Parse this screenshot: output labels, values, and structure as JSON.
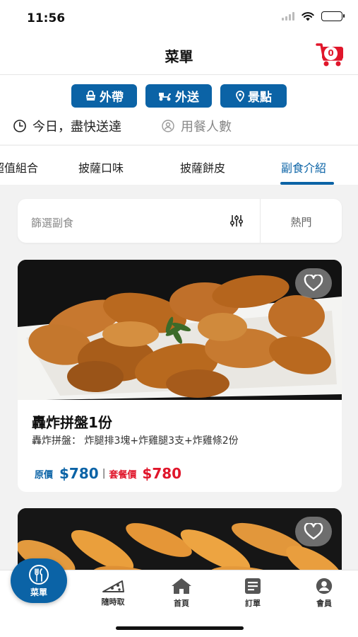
{
  "status_bar": {
    "time": "11:56"
  },
  "header": {
    "title": "菜單",
    "cart_count": "0"
  },
  "order_modes": [
    {
      "label": "外帶",
      "icon": "takeout-icon"
    },
    {
      "label": "外送",
      "icon": "delivery-scooter-icon"
    },
    {
      "label": "景點",
      "icon": "location-pin-icon"
    }
  ],
  "delivery_info": {
    "time_text": "今日，盡快送達",
    "diners_text": "用餐人數"
  },
  "category_tabs": [
    {
      "label": "超值組合"
    },
    {
      "label": "披薩口味"
    },
    {
      "label": "披薩餅皮"
    },
    {
      "label": "副食介紹",
      "active": true
    }
  ],
  "filter": {
    "label": "篩選副食",
    "sort": "熱門"
  },
  "products": [
    {
      "title": "轟炸拼盤1份",
      "description": "轟炸拼盤： 炸腿排3塊+炸雞腿3支+炸雞條2份",
      "original_price_label": "原價",
      "original_price": "$780",
      "separator": "|",
      "set_price_label": "套餐價",
      "set_price": "$780"
    },
    {
      "title": ""
    }
  ],
  "bottom_nav": {
    "items": [
      {
        "label": "菜單",
        "icon": "cutlery-icon",
        "active": true
      },
      {
        "label": "隨時取",
        "icon": "pizza-slice-icon"
      },
      {
        "label": "首頁",
        "icon": "home-icon"
      },
      {
        "label": "訂單",
        "icon": "order-list-icon"
      },
      {
        "label": "會員",
        "icon": "user-icon"
      }
    ]
  },
  "colors": {
    "brand_blue": "#0b63a6",
    "brand_red": "#e0162b"
  }
}
